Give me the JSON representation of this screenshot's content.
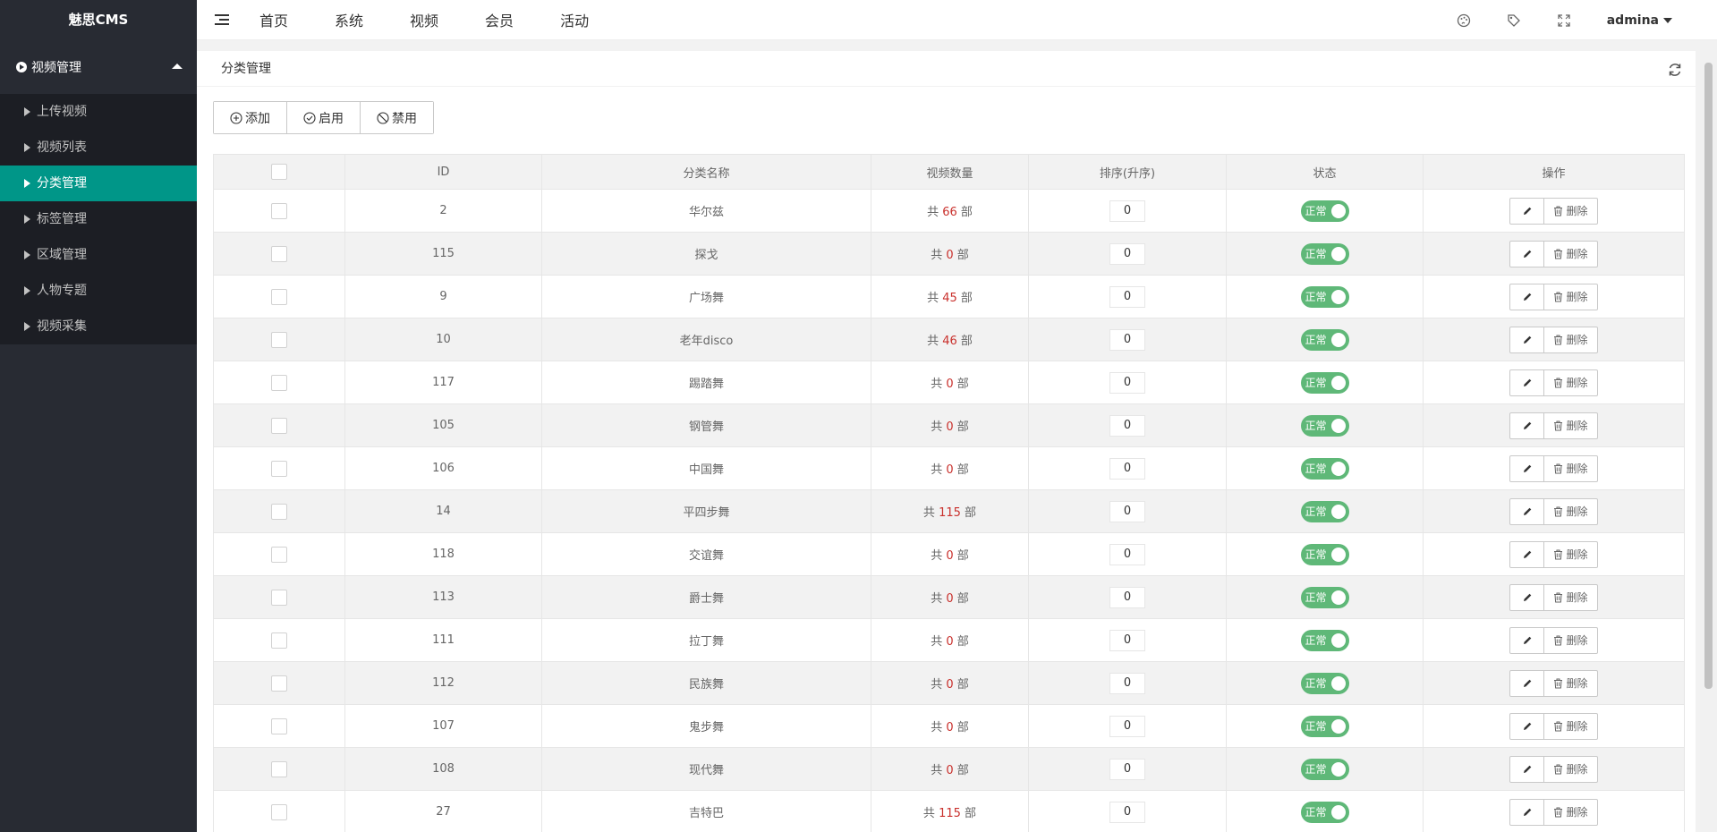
{
  "app": {
    "logo": "魅思CMS"
  },
  "sidebar": {
    "group_label": "视频管理",
    "items": [
      {
        "label": "上传视频",
        "active": false
      },
      {
        "label": "视频列表",
        "active": false
      },
      {
        "label": "分类管理",
        "active": true
      },
      {
        "label": "标签管理",
        "active": false
      },
      {
        "label": "区域管理",
        "active": false
      },
      {
        "label": "人物专题",
        "active": false
      },
      {
        "label": "视频采集",
        "active": false
      }
    ]
  },
  "topnav": {
    "items": [
      "首页",
      "系统",
      "视频",
      "会员",
      "活动"
    ],
    "user": "admina"
  },
  "panel": {
    "title": "分类管理",
    "toolbar": {
      "add": "添加",
      "enable": "启用",
      "disable": "禁用"
    }
  },
  "table": {
    "headers": {
      "id": "ID",
      "name": "分类名称",
      "count": "视频数量",
      "sort": "排序(升序)",
      "status": "状态",
      "ops": "操作"
    },
    "count_prefix": "共",
    "count_suffix": "部",
    "status_label": "正常",
    "delete_label": "删除",
    "rows": [
      {
        "id": "2",
        "name": "华尔兹",
        "count": "66",
        "sort": "0"
      },
      {
        "id": "115",
        "name": "探戈",
        "count": "0",
        "sort": "0"
      },
      {
        "id": "9",
        "name": "广场舞",
        "count": "45",
        "sort": "0"
      },
      {
        "id": "10",
        "name": "老年disco",
        "count": "46",
        "sort": "0"
      },
      {
        "id": "117",
        "name": "踢踏舞",
        "count": "0",
        "sort": "0"
      },
      {
        "id": "105",
        "name": "钢管舞",
        "count": "0",
        "sort": "0"
      },
      {
        "id": "106",
        "name": "中国舞",
        "count": "0",
        "sort": "0"
      },
      {
        "id": "14",
        "name": "平四步舞",
        "count": "115",
        "sort": "0"
      },
      {
        "id": "118",
        "name": "交谊舞",
        "count": "0",
        "sort": "0"
      },
      {
        "id": "113",
        "name": "爵士舞",
        "count": "0",
        "sort": "0"
      },
      {
        "id": "111",
        "name": "拉丁舞",
        "count": "0",
        "sort": "0"
      },
      {
        "id": "112",
        "name": "民族舞",
        "count": "0",
        "sort": "0"
      },
      {
        "id": "107",
        "name": "鬼步舞",
        "count": "0",
        "sort": "0"
      },
      {
        "id": "108",
        "name": "现代舞",
        "count": "0",
        "sort": "0"
      },
      {
        "id": "27",
        "name": "吉特巴",
        "count": "115",
        "sort": "0"
      }
    ]
  },
  "colors": {
    "sidebar_bg": "#282b33",
    "active": "#009688",
    "switch_on": "#5fb878",
    "count_highlight": "#c9302c"
  }
}
